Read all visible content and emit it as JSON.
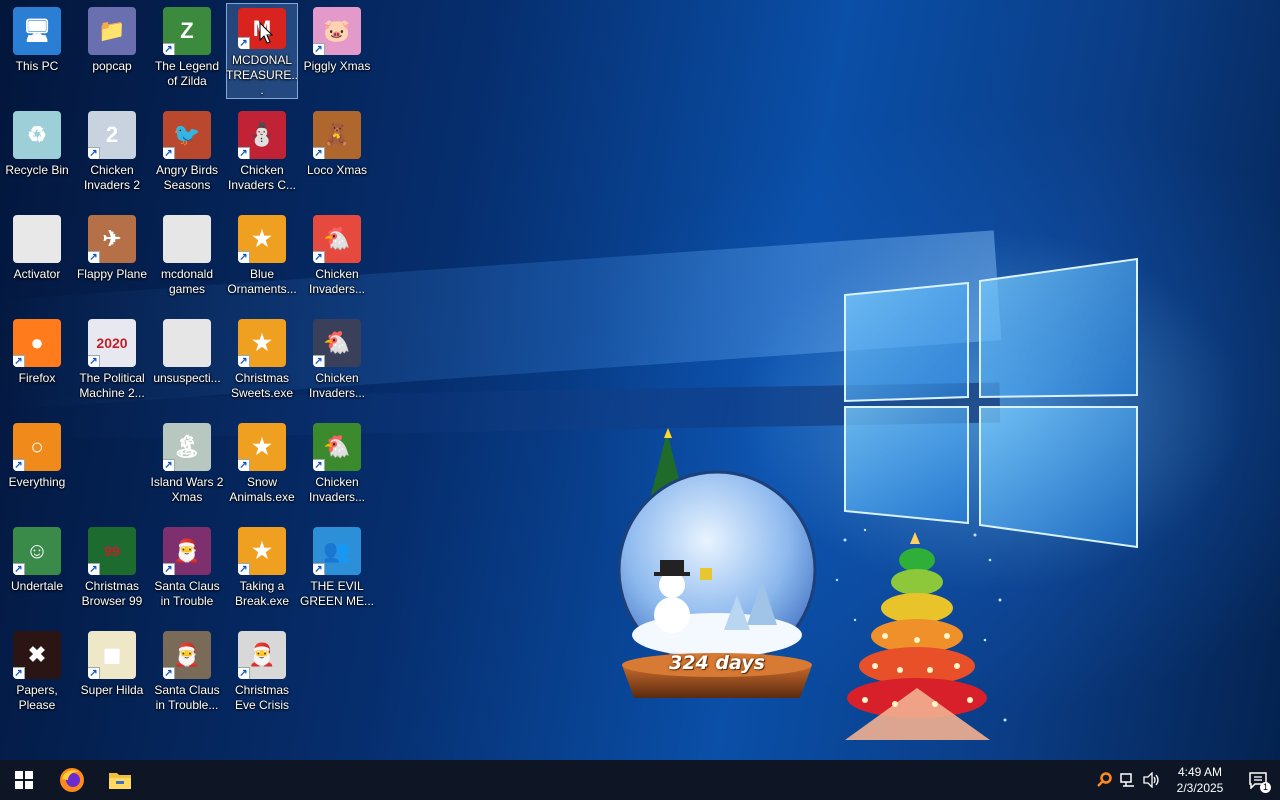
{
  "desktop": {
    "icons": [
      {
        "label": "This PC",
        "icon": "computer-icon",
        "color": "#2a7fd4",
        "glyph": "🖥",
        "shortcut": false
      },
      {
        "label": "popcap",
        "icon": "popcap-folder-icon",
        "color": "#6a6fb0",
        "glyph": "📁",
        "shortcut": false
      },
      {
        "label": "The Legend of Zilda",
        "icon": "zilda-game-icon",
        "color": "#3b8a3e",
        "glyph": "Z",
        "shortcut": true
      },
      {
        "label": "MCDONAL TREASURE...",
        "icon": "mcdonalds-game-icon",
        "color": "#d8231e",
        "glyph": "M",
        "shortcut": true,
        "selected": true
      },
      {
        "label": "Piggly Xmas",
        "icon": "piggly-xmas-icon",
        "color": "#e39acb",
        "glyph": "🐷",
        "shortcut": true
      },
      {
        "label": "Recycle Bin",
        "icon": "recycle-bin-icon",
        "color": "#9ccfd8",
        "glyph": "♻",
        "shortcut": false
      },
      {
        "label": "Chicken Invaders 2",
        "icon": "chicken-invaders-2-icon",
        "color": "#c9d3e0",
        "glyph": "2",
        "shortcut": true
      },
      {
        "label": "Angry Birds Seasons",
        "icon": "angry-birds-seasons-icon",
        "color": "#b9482e",
        "glyph": "🐦",
        "shortcut": true
      },
      {
        "label": "Chicken Invaders C...",
        "icon": "chicken-invaders-christmas-icon",
        "color": "#c22236",
        "glyph": "⛄",
        "shortcut": true
      },
      {
        "label": "Loco Xmas",
        "icon": "loco-xmas-icon",
        "color": "#b0672e",
        "glyph": "🧸",
        "shortcut": true
      },
      {
        "label": "Activator",
        "icon": "blank-file-icon",
        "color": "#e8e8e8",
        "glyph": "",
        "shortcut": false
      },
      {
        "label": "Flappy Plane",
        "icon": "flappy-plane-icon",
        "color": "#b57048",
        "glyph": "✈",
        "shortcut": true
      },
      {
        "label": "mcdonald games",
        "icon": "folder-icon",
        "color": "#e6e6e6",
        "glyph": "",
        "shortcut": false
      },
      {
        "label": "Blue Ornaments...",
        "icon": "blue-ornaments-icon",
        "color": "#f0a020",
        "glyph": "★",
        "shortcut": true
      },
      {
        "label": "Chicken Invaders...",
        "icon": "chicken-invaders-icon",
        "color": "#e64a3e",
        "glyph": "🐔",
        "shortcut": true
      },
      {
        "label": "Firefox",
        "icon": "firefox-icon",
        "color": "#ff7b1b",
        "glyph": "●",
        "shortcut": true
      },
      {
        "label": "The Political Machine 2...",
        "icon": "political-machine-icon",
        "color": "#e8e8f0",
        "glyph": "2020",
        "shortcut": true
      },
      {
        "label": "unsuspecti...",
        "icon": "folder-icon",
        "color": "#e6e6e6",
        "glyph": "",
        "shortcut": false
      },
      {
        "label": "Christmas Sweets.exe",
        "icon": "christmas-sweets-icon",
        "color": "#f0a020",
        "glyph": "★",
        "shortcut": true
      },
      {
        "label": "Chicken Invaders...",
        "icon": "chicken-invaders-icon",
        "color": "#3a3f5a",
        "glyph": "🐔",
        "shortcut": true
      },
      {
        "label": "Everything",
        "icon": "everything-search-icon",
        "color": "#f08a1b",
        "glyph": "○",
        "shortcut": true
      },
      {
        "label": "",
        "icon": "",
        "color": "",
        "glyph": "",
        "shortcut": false,
        "empty": true
      },
      {
        "label": "Island Wars 2 Xmas",
        "icon": "island-wars-icon",
        "color": "#b8c8c0",
        "glyph": "🏝",
        "shortcut": true
      },
      {
        "label": "Snow Animals.exe",
        "icon": "snow-animals-icon",
        "color": "#f0a020",
        "glyph": "★",
        "shortcut": true
      },
      {
        "label": "Chicken Invaders...",
        "icon": "chicken-invaders-icon",
        "color": "#3c8a2e",
        "glyph": "🐔",
        "shortcut": true
      },
      {
        "label": "Undertale",
        "icon": "undertale-icon",
        "color": "#3a8a4a",
        "glyph": "☺",
        "shortcut": true
      },
      {
        "label": "Christmas Browser 99",
        "icon": "christmas-browser-icon",
        "color": "#1d6b2e",
        "glyph": "99",
        "shortcut": true
      },
      {
        "label": "Santa Claus in Trouble",
        "icon": "santa-claus-trouble-icon",
        "color": "#7d2f6e",
        "glyph": "🎅",
        "shortcut": true
      },
      {
        "label": "Taking a Break.exe",
        "icon": "taking-a-break-icon",
        "color": "#f0a020",
        "glyph": "★",
        "shortcut": true
      },
      {
        "label": "THE EVIL GREEN ME...",
        "icon": "messenger-icon",
        "color": "#2d8fd8",
        "glyph": "👥",
        "shortcut": true
      },
      {
        "label": "Papers, Please",
        "icon": "papers-please-icon",
        "color": "#2b1414",
        "glyph": "✖",
        "shortcut": true
      },
      {
        "label": "Super Hilda",
        "icon": "super-hilda-icon",
        "color": "#eee8c8",
        "glyph": "◼",
        "shortcut": true
      },
      {
        "label": "Santa Claus in Trouble...",
        "icon": "santa-claus-trouble-icon",
        "color": "#7a6a58",
        "glyph": "🎅",
        "shortcut": true
      },
      {
        "label": "Christmas Eve Crisis",
        "icon": "christmas-eve-crisis-icon",
        "color": "#d8d8d8",
        "glyph": "🎅",
        "shortcut": true
      }
    ]
  },
  "gadgets": {
    "snow_globe": {
      "days": "324 days"
    }
  },
  "taskbar": {
    "pinned": [
      {
        "name": "start-button",
        "icon": "windows-logo-icon"
      },
      {
        "name": "firefox-taskbar-button",
        "icon": "firefox-icon"
      },
      {
        "name": "file-explorer-taskbar-button",
        "icon": "folder-icon"
      }
    ],
    "clock": {
      "time": "4:49 AM",
      "date": "2/3/2025"
    },
    "notification_count": "1"
  }
}
